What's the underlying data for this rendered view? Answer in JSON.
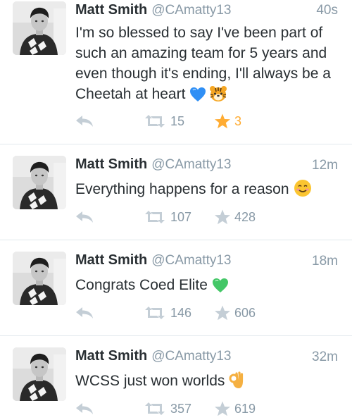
{
  "colors": {
    "text": "#292f33",
    "muted": "#8899a6",
    "star_active": "#ffac33",
    "icon": "#c4ced6",
    "divider": "#e1e8ed"
  },
  "tweets": [
    {
      "name": "Matt Smith",
      "handle": "@CAmatty13",
      "time": "40s",
      "text": "I'm so blessed to say I've been part of such an amazing team for 5 years and even though it's ending, I'll always be a Cheetah at heart",
      "emojis": [
        "blue-heart-icon",
        "tiger-face-icon"
      ],
      "retweets": "15",
      "favorites": "3",
      "favorited": true
    },
    {
      "name": "Matt Smith",
      "handle": "@CAmatty13",
      "time": "12m",
      "text": "Everything happens for a reason",
      "emojis": [
        "smiling-face-icon"
      ],
      "retweets": "107",
      "favorites": "428",
      "favorited": false
    },
    {
      "name": "Matt Smith",
      "handle": "@CAmatty13",
      "time": "18m",
      "text": "Congrats Coed Elite",
      "emojis": [
        "green-heart-icon"
      ],
      "retweets": "146",
      "favorites": "606",
      "favorited": false
    },
    {
      "name": "Matt Smith",
      "handle": "@CAmatty13",
      "time": "32m",
      "text": "WCSS just won worlds",
      "emojis": [
        "ok-hand-icon"
      ],
      "retweets": "357",
      "favorites": "619",
      "favorited": false
    }
  ]
}
